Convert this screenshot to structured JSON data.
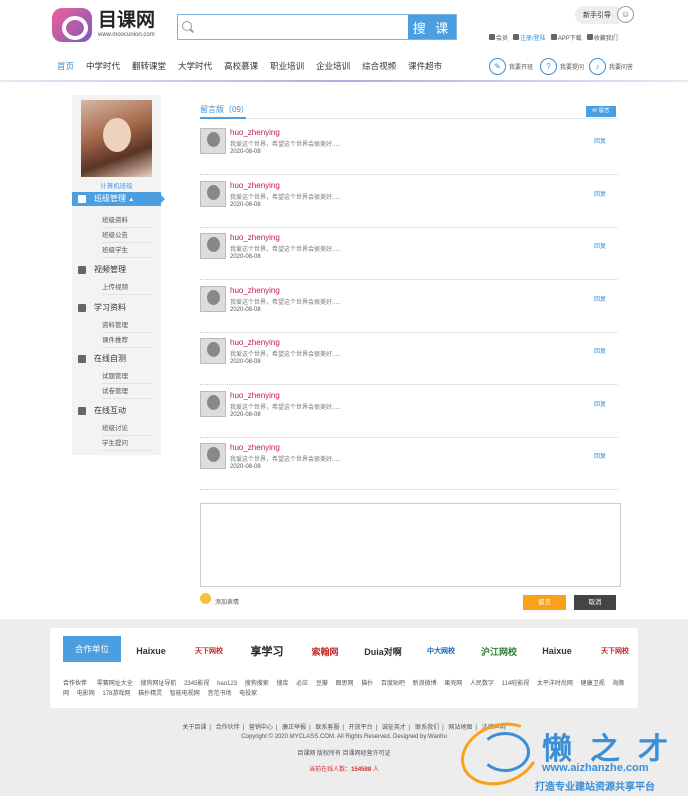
{
  "header": {
    "logo_cn": "目课网",
    "logo_en": "www.moocunion.com",
    "search_placeholder": "",
    "search_button": "搜 课",
    "guide": "新手引导",
    "toplinks": {
      "member": "会员",
      "login": "注册/登陆",
      "app": "APP下载",
      "fav": "收藏我们"
    }
  },
  "nav": {
    "items": [
      "首页",
      "中学时代",
      "翻转课堂",
      "大学时代",
      "高校慕课",
      "职业培训",
      "企业培训",
      "综合视频",
      "课件超市"
    ],
    "quick": [
      "我要开班",
      "我要提问",
      "我要问答"
    ]
  },
  "sidebar": {
    "name": "计算机班级",
    "sections": [
      {
        "label": "班级管理",
        "subs": [
          "班级资料",
          "班级公告",
          "班级学生"
        ]
      },
      {
        "label": "视频管理",
        "subs": [
          "上传视频"
        ]
      },
      {
        "label": "学习资料",
        "subs": [
          "资料管理",
          "课件推荐"
        ]
      },
      {
        "label": "在线自测",
        "subs": [
          "试题管理",
          "试卷管理"
        ]
      },
      {
        "label": "在线互动",
        "subs": [
          "班级讨论",
          "学生提问"
        ]
      }
    ]
  },
  "main": {
    "title": "留言版（09）",
    "message_button": "留言",
    "messages": [
      {
        "user": "huo_zhenying",
        "text": "我爱这个世界，希望这个世界会很美好.....",
        "date": "2020-08-08",
        "reply": "回复"
      },
      {
        "user": "huo_zhenying",
        "text": "我爱这个世界，希望这个世界会很美好.....",
        "date": "2020-08-08",
        "reply": "回复"
      },
      {
        "user": "huo_zhenying",
        "text": "我爱这个世界，希望这个世界会很美好.....",
        "date": "2020-08-08",
        "reply": "回复"
      },
      {
        "user": "huo_zhenying",
        "text": "我爱这个世界，希望这个世界会很美好.....",
        "date": "2020-08-08",
        "reply": "回复"
      },
      {
        "user": "huo_zhenying",
        "text": "我爱这个世界，希望这个世界会很美好.....",
        "date": "2020-08-08",
        "reply": "回复"
      },
      {
        "user": "huo_zhenying",
        "text": "我爱这个世界，希望这个世界会很美好.....",
        "date": "2020-08-08",
        "reply": "回复"
      },
      {
        "user": "huo_zhenying",
        "text": "我爱这个世界，希望这个世界会很美好.....",
        "date": "2020-08-08",
        "reply": "回复"
      }
    ],
    "emoji_label": "添加表情",
    "submit": "留言",
    "cancel": "取消"
  },
  "partners": {
    "heading": "合作单位",
    "logos": [
      "Haixue",
      "天下网校",
      "享学习",
      "索翰网",
      "Duia对啊",
      "中大网校",
      "沪江网校",
      "Haixue",
      "天下网校"
    ],
    "links_label": "合作伙伴",
    "links": [
      "零赛网址大全",
      "搜狗网址导航",
      "2345影视",
      "hao123",
      "搜狗搜索",
      "搜库",
      "必应",
      "豆瓣",
      "图思网",
      "猫扑",
      "百度贴吧",
      "新浪微博",
      "果壳网",
      "人民数字",
      "114啦影视",
      "太平洋时尚网",
      "健康卫视",
      "海豚网",
      "电影网",
      "178游戏网",
      "猫扑精灵",
      "智能电视网",
      "音范书场",
      "电投家"
    ]
  },
  "footer": {
    "links": [
      "关于目课",
      "合作伙伴",
      "营销中心",
      "廉正举报",
      "联系客服",
      "开放平台",
      "诚征英才",
      "联系我们",
      "网站地图",
      "法律声明"
    ],
    "copyright": "Copyright © 2020 MYCLASS.COM. All Rights Reserved. Designed by:Wanhu",
    "icp": "目课网 版权所有 目课网经营许可证",
    "online_label": "当前在线人数：",
    "online_count": "154588",
    "online_unit": "人"
  },
  "watermark": {
    "cn": "懒之才",
    "url": "www.aizhanzhe.com",
    "tag": "打造专业建站资源共享平台"
  }
}
